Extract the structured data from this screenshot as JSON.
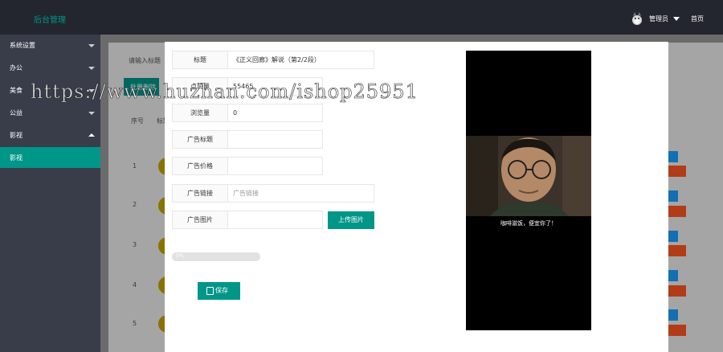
{
  "header": {
    "brand": "后台管理",
    "user_label": "管理员",
    "home_label": "首页"
  },
  "sidebar": {
    "items": [
      {
        "label": "系统设置"
      },
      {
        "label": "办公"
      },
      {
        "label": "美食"
      },
      {
        "label": "公益"
      },
      {
        "label": "影视"
      }
    ],
    "sub_items": [
      {
        "label": "影视"
      }
    ]
  },
  "background": {
    "search_placeholder": "请输入标题",
    "button_label": "批量删除",
    "column_headers": [
      "序号",
      "标题"
    ],
    "row_numbers": [
      "1",
      "2",
      "3",
      "4",
      "5"
    ]
  },
  "form": {
    "title_label": "标题",
    "title_value": "《正义回廊》解说（第2/2段）",
    "likes_label": "点赞量",
    "likes_value": "55465",
    "views_label": "浏览量",
    "views_value": "0",
    "ad_title_label": "广告标题",
    "ad_title_value": "",
    "ad_price_label": "广告价格",
    "ad_price_value": "",
    "ad_link_label": "广告链接",
    "ad_link_placeholder": "广告链接",
    "ad_image_label": "广告图片",
    "ad_image_value": "",
    "upload_label": "上传图片",
    "progress_text": "0%",
    "progress_value": 0,
    "save_label": "保存"
  },
  "video": {
    "caption": "咖啡滋饭，便宜你了！"
  },
  "watermark": "https://www.huzhan.com/ishop25951",
  "colors": {
    "accent": "#009688",
    "header_bg": "#23262e",
    "sidebar_bg": "#393d49",
    "danger": "#ff5722",
    "info": "#1e9fff"
  }
}
